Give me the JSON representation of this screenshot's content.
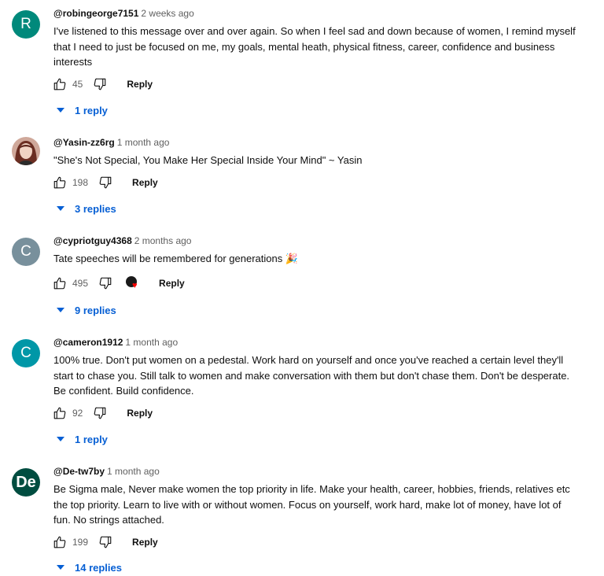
{
  "colors": {
    "link": "#065fd4",
    "heart": "#ff0000"
  },
  "comments": [
    {
      "avatar_letter": "R",
      "avatar_color": "#00897b",
      "author": "@robingeorge7151",
      "time": "2 weeks ago",
      "lines": [
        "I've listened to this message over and over again. So when I feel sad and down because of women, I remind myself",
        "that I need to just be focused on me, my goals, mental heath, physical fitness, career, confidence and business",
        "interests"
      ],
      "likes": "45",
      "reply_label": "Reply",
      "replies_label": "1 reply"
    },
    {
      "avatar_letter": "",
      "avatar_color": "#8d5a4a",
      "author": "@Yasin-zz6rg",
      "time": "1 month ago",
      "lines": [
        "\"She's Not Special, You Make Her Special Inside Your Mind\" ~ Yasin"
      ],
      "likes": "198",
      "reply_label": "Reply",
      "replies_label": "3 replies"
    },
    {
      "avatar_letter": "C",
      "avatar_color": "#78909c",
      "author": "@cypriotguy4368",
      "time": "2 months ago",
      "lines": [
        "Tate speeches will be remembered for generations 🎉"
      ],
      "likes": "495",
      "reply_label": "Reply",
      "replies_label": "9 replies"
    },
    {
      "avatar_letter": "C",
      "avatar_color": "#0097a7",
      "author": "@cameron1912",
      "time": "1 month ago",
      "lines": [
        "100% true. Don't put women on a pedestal. Work hard on yourself and once you've reached a certain level they'll",
        "start to chase you. Still talk to women and make conversation with them but don't chase them. Don't be desperate.",
        "Be confident. Build confidence."
      ],
      "likes": "92",
      "reply_label": "Reply",
      "replies_label": "1 reply"
    },
    {
      "avatar_letter": "De",
      "avatar_color": "#004d40",
      "author": "@De-tw7by",
      "time": "1 month ago",
      "lines": [
        "Be Sigma male, Never make women the top priority in life. Make your health, career, hobbies, friends, relatives etc",
        "the top priority. Learn to live with or without women. Focus on yourself, work hard, make lot of money, have lot of",
        "fun. No strings attached."
      ],
      "likes": "199",
      "reply_label": "Reply",
      "replies_label": "14 replies"
    }
  ]
}
